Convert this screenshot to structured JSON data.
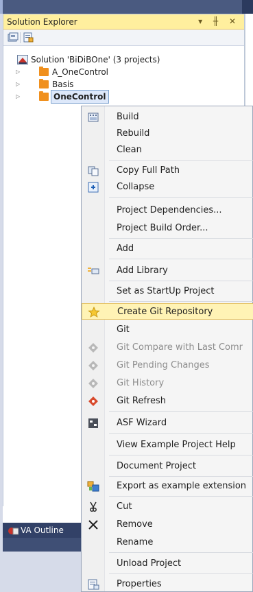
{
  "panel": {
    "title": "Solution Explorer",
    "title_buttons": "▾ ╫ ✕"
  },
  "tree": {
    "solution_label": "Solution 'BiDiBOne' (3 projects)",
    "projects": [
      {
        "label": "A_OneControl"
      },
      {
        "label": "Basis"
      },
      {
        "label": "OneControl"
      }
    ]
  },
  "va_outline": {
    "label": "VA Outline"
  },
  "context_menu": {
    "items": [
      {
        "label": "Build",
        "icon": "build-icon"
      },
      {
        "label": "Rebuild"
      },
      {
        "label": "Clean"
      },
      {
        "label": "Copy Full Path",
        "icon": "copy-icon"
      },
      {
        "label": "Collapse",
        "icon": "collapse-icon"
      },
      {
        "label": "Project Dependencies..."
      },
      {
        "label": "Project Build Order..."
      },
      {
        "label": "Add"
      },
      {
        "label": "Add Library",
        "icon": "library-icon"
      },
      {
        "label": "Set as StartUp Project"
      },
      {
        "label": "Create Git Repository",
        "icon": "star-icon"
      },
      {
        "label": "Git"
      },
      {
        "label": "Git Compare with Last Comr",
        "icon": "git-icon"
      },
      {
        "label": "Git Pending Changes",
        "icon": "git-icon"
      },
      {
        "label": "Git History",
        "icon": "git-icon"
      },
      {
        "label": "Git Refresh",
        "icon": "git-icon"
      },
      {
        "label": "ASF Wizard",
        "icon": "asf-icon"
      },
      {
        "label": "View Example Project Help"
      },
      {
        "label": "Document Project"
      },
      {
        "label": "Export as example extension",
        "icon": "export-icon"
      },
      {
        "label": "Cut",
        "icon": "scissors-icon"
      },
      {
        "label": "Remove",
        "icon": "x-icon"
      },
      {
        "label": "Rename"
      },
      {
        "label": "Unload Project"
      },
      {
        "label": "Properties",
        "icon": "properties-icon"
      }
    ]
  },
  "colors": {
    "title_bar": "#ffef9e",
    "menu_highlight": "#fff3b5",
    "folder": "#f0901e",
    "git_red": "#d84a2c",
    "dark_band": "#3f4f75"
  }
}
